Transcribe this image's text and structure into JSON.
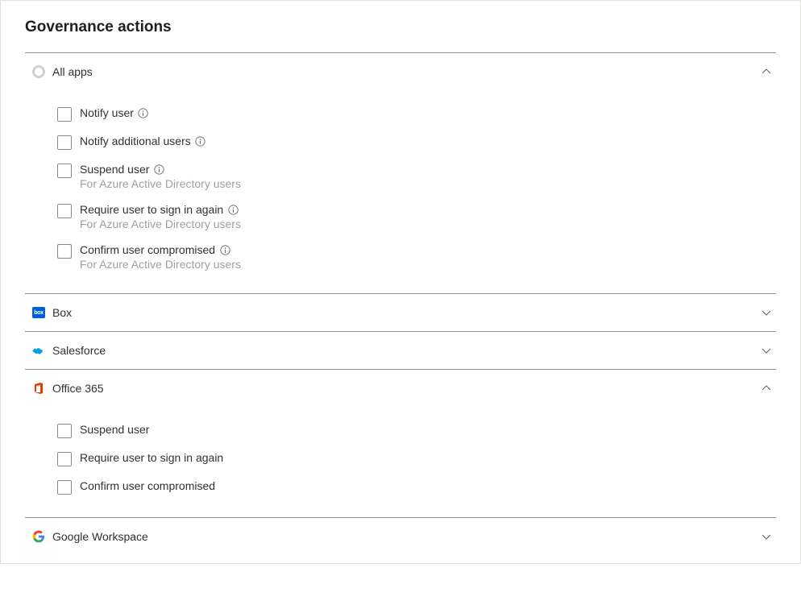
{
  "title": "Governance actions",
  "sections": [
    {
      "key": "all_apps",
      "title": "All apps",
      "expanded": true,
      "actions": [
        {
          "label": "Notify user",
          "info": true
        },
        {
          "label": "Notify additional users",
          "info": true
        },
        {
          "label": "Suspend user",
          "info": true,
          "subtext": "For Azure Active Directory users"
        },
        {
          "label": "Require user to sign in again",
          "info": true,
          "subtext": "For Azure Active Directory users"
        },
        {
          "label": "Confirm user compromised",
          "info": true,
          "subtext": "For Azure Active Directory users"
        }
      ]
    },
    {
      "key": "box",
      "title": "Box",
      "expanded": false
    },
    {
      "key": "salesforce",
      "title": "Salesforce",
      "expanded": false
    },
    {
      "key": "office365",
      "title": "Office 365",
      "expanded": true,
      "actions": [
        {
          "label": "Suspend user"
        },
        {
          "label": "Require user to sign in again"
        },
        {
          "label": "Confirm user compromised"
        }
      ]
    },
    {
      "key": "google",
      "title": "Google Workspace",
      "expanded": false
    }
  ]
}
